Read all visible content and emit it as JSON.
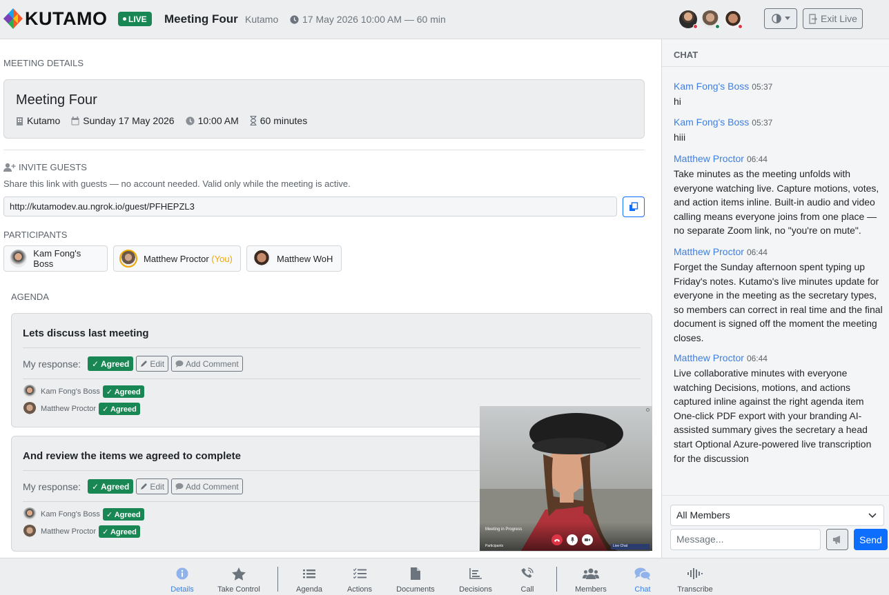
{
  "header": {
    "logo_text": "KUTAMO",
    "live_badge": "LIVE",
    "meeting_title": "Meeting Four",
    "org": "Kutamo",
    "datetime": "17 May 2026 10:00 AM — 60 min",
    "exit_label": "Exit Live"
  },
  "details": {
    "section_label": "MEETING DETAILS",
    "title": "Meeting Four",
    "org": "Kutamo",
    "date": "Sunday 17 May 2026",
    "time": "10:00 AM",
    "duration": "60 minutes"
  },
  "invite": {
    "section_label": "INVITE GUESTS",
    "description": "Share this link with guests — no account needed. Valid only while the meeting is active.",
    "link": "http://kutamodev.au.ngrok.io/guest/PFHEPZL3"
  },
  "participants": {
    "section_label": "PARTICIPANTS",
    "items": [
      {
        "name": "Kam Fong's Boss"
      },
      {
        "name": "Matthew Proctor",
        "tag": "(You)"
      },
      {
        "name": "Matthew WoH"
      }
    ]
  },
  "agenda": {
    "section_label": "AGENDA",
    "response_label": "My response:",
    "agreed_label": "✓ Agreed",
    "edit_label": "Edit",
    "comment_label": "Add Comment",
    "items": [
      {
        "title": "Lets discuss last meeting",
        "votes": [
          {
            "name": "Kam Fong's Boss",
            "status": "✓ Agreed"
          },
          {
            "name": "Matthew Proctor",
            "status": "✓ Agreed"
          }
        ]
      },
      {
        "title": "And review the items we agreed to complete",
        "votes": [
          {
            "name": "Kam Fong's Boss",
            "status": "✓ Agreed"
          },
          {
            "name": "Matthew Proctor",
            "status": "✓ Agreed"
          }
        ]
      }
    ]
  },
  "video": {
    "status": "Meeting in Progress",
    "participants_label": "Participants",
    "live_label": "Live Chat"
  },
  "chat": {
    "title": "CHAT",
    "messages": [
      {
        "author": "Kam Fong's Boss",
        "time": "05:37",
        "text": "hi"
      },
      {
        "author": "Kam Fong's Boss",
        "time": "05:37",
        "text": "hiii"
      },
      {
        "author": "Matthew Proctor",
        "time": "06:44",
        "text": "Take minutes as the meeting unfolds with everyone watching live. Capture motions, votes, and action items inline. Built-in audio and video calling means everyone joins from one place — no separate Zoom link, no \"you're on mute\"."
      },
      {
        "author": "Matthew Proctor",
        "time": "06:44",
        "text": "Forget the Sunday afternoon spent typing up Friday's notes. Kutamo's live minutes update for everyone in the meeting as the secretary types, so members can correct in real time and the final document is signed off the moment the meeting closes."
      },
      {
        "author": "Matthew Proctor",
        "time": "06:44",
        "text": "Live collaborative minutes with everyone watching Decisions, motions, and actions captured inline against the right agenda item One-click PDF export with your branding AI-assisted summary gives the secretary a head start Optional Azure-powered live transcription for the discussion"
      }
    ],
    "recipient": "All Members",
    "message_placeholder": "Message...",
    "send_label": "Send"
  },
  "nav": {
    "items": [
      {
        "label": "Details",
        "icon": "info-icon"
      },
      {
        "label": "Take Control",
        "icon": "star-icon"
      },
      {
        "label": "Agenda",
        "icon": "list-icon"
      },
      {
        "label": "Actions",
        "icon": "checklist-icon"
      },
      {
        "label": "Documents",
        "icon": "document-icon"
      },
      {
        "label": "Decisions",
        "icon": "chart-icon"
      },
      {
        "label": "Call",
        "icon": "phone-icon"
      },
      {
        "label": "Members",
        "icon": "people-icon"
      },
      {
        "label": "Chat",
        "icon": "chat-icon"
      },
      {
        "label": "Transcribe",
        "icon": "waveform-icon"
      }
    ]
  },
  "colors": {
    "primary": "#0d6efd",
    "success": "#198754",
    "link": "#3d7ee0",
    "you": "#f0a800"
  }
}
